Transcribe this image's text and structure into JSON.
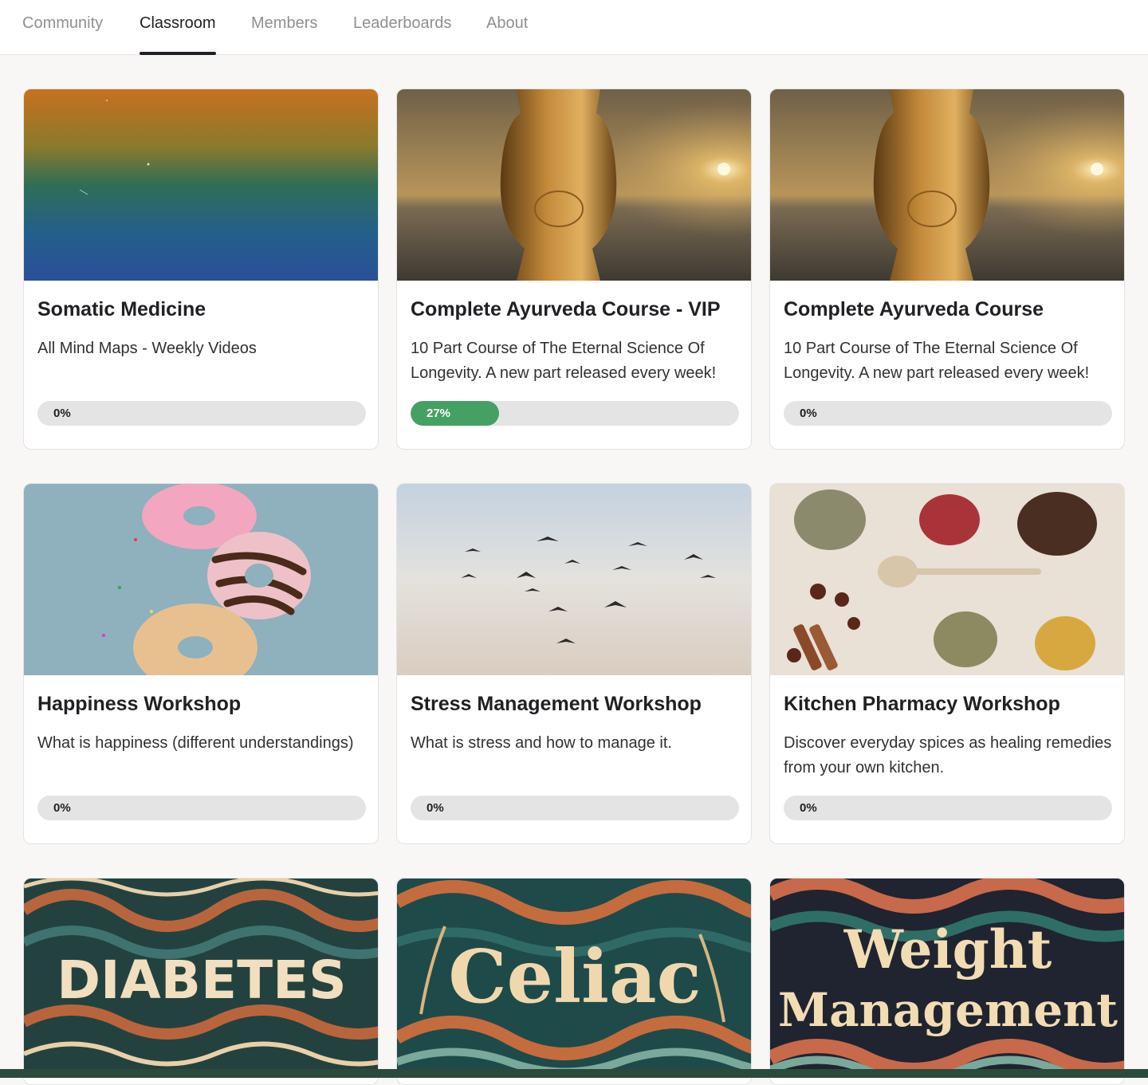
{
  "nav": {
    "tabs": [
      {
        "label": "Community"
      },
      {
        "label": "Classroom",
        "active": true
      },
      {
        "label": "Members"
      },
      {
        "label": "Leaderboards"
      },
      {
        "label": "About"
      }
    ]
  },
  "courses": [
    {
      "title": "Somatic Medicine",
      "description": "All Mind Maps - Weekly Videos",
      "progress_label": "0%",
      "progress": 0
    },
    {
      "title": "Complete Ayurveda Course - VIP",
      "description": "10 Part Course of The Eternal Science Of Longevity. A new part released every week!",
      "progress_label": "27%",
      "progress": 0.27
    },
    {
      "title": "Complete Ayurveda Course",
      "description": "10 Part Course of The Eternal Science Of Longevity. A new part released every week!",
      "progress_label": "0%",
      "progress": 0
    },
    {
      "title": "Happiness Workshop",
      "description": "What is happiness (different understandings)",
      "progress_label": "0%",
      "progress": 0
    },
    {
      "title": "Stress Management Workshop",
      "description": "What is stress and how to manage it.",
      "progress_label": "0%",
      "progress": 0
    },
    {
      "title": "Kitchen Pharmacy Workshop",
      "description": "Discover everyday spices as healing remedies from your own kitchen.",
      "progress_label": "0%",
      "progress": 0
    },
    {
      "image_text": "DIABETES"
    },
    {
      "image_text": "Celiac"
    },
    {
      "image_text": "Weight Management"
    }
  ],
  "colors": {
    "progress_fill": "#45a063",
    "progress_track": "#e4e4e4",
    "bottom_bar": "#2c4a3c"
  }
}
